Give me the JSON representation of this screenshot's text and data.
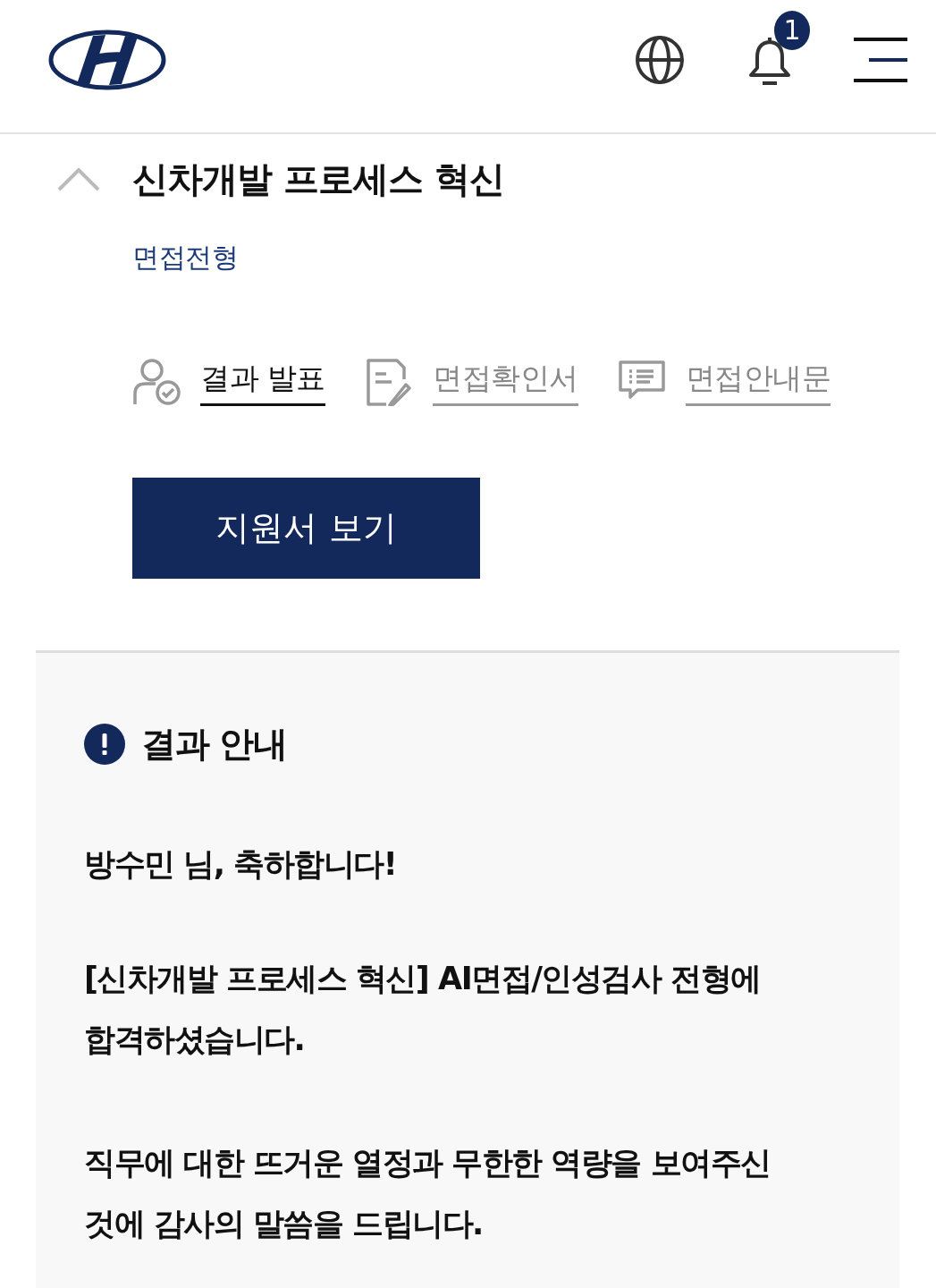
{
  "header": {
    "notification_count": "1"
  },
  "section": {
    "title": "신차개발 프로세스 혁신",
    "expanded": true,
    "stage": "면접전형",
    "links": [
      {
        "label": "결과 발표",
        "selected": true,
        "kind": "result"
      },
      {
        "label": "면접확인서",
        "selected": false,
        "kind": "confirmation"
      },
      {
        "label": "면접안내문",
        "selected": false,
        "kind": "guide"
      }
    ],
    "button": "지원서 보기"
  },
  "notice": {
    "title": "결과 안내",
    "greeting": "방수민 님, 축하합니다!",
    "paragraphs": [
      "[신차개발 프로세스 혁신] AI면접/인성검사 전형에 합격하셨습니다.",
      "직무에 대한 뜨거운 열정과 무한한 역량을 보여주신 것에 감사의 말씀을 드립니다."
    ]
  }
}
